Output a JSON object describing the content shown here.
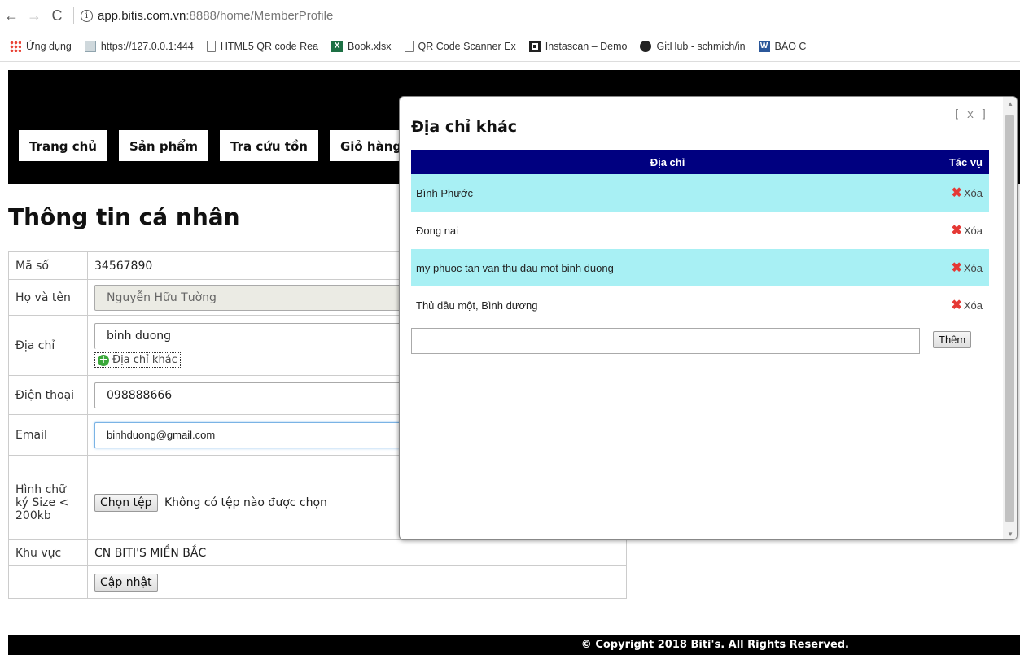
{
  "browser": {
    "url_host": "app.bitis.com.vn",
    "url_path": ":8888/home/MemberProfile",
    "bookmarks": [
      "Ứng dụng",
      "https://127.0.0.1:444",
      "HTML5 QR code Rea",
      "Book.xlsx",
      "QR Code Scanner Ex",
      "Instascan – Demo",
      "GitHub - schmich/in",
      "BÁO C"
    ]
  },
  "header": {
    "menu": [
      "Trang chủ",
      "Sản phẩm",
      "Tra cứu tồn",
      "Giỏ hàng"
    ]
  },
  "profile": {
    "title": "Thông tin cá nhân",
    "labels": {
      "ma_so": "Mã số",
      "ho_ten": "Họ và tên",
      "dia_chi": "Địa chỉ",
      "dien_thoai": "Điện thoại",
      "email": "Email",
      "hinh_chu_ky": "Hình chữ ký Size < 200kb",
      "khu_vuc": "Khu vực"
    },
    "values": {
      "ma_so": "34567890",
      "ho_ten": "Nguyễn Hữu Tường",
      "dia_chi": "binh duong",
      "dien_thoai": "098888666",
      "email": "binhduong@gmail.com",
      "file_status": "Không có tệp nào được chọn",
      "khu_vuc": "CN BITI'S MIỀN BẮC"
    },
    "other_address_link": "Địa chỉ khác",
    "choose_file_button": "Chọn tệp",
    "update_button": "Cập nhật"
  },
  "modal": {
    "title": "Địa chỉ khác",
    "close": "[ x ]",
    "col_address": "Địa chỉ",
    "col_action": "Tác vụ",
    "rows": [
      {
        "address": "Bình Phước",
        "action": "Xóa"
      },
      {
        "address": "Đong nai",
        "action": "Xóa"
      },
      {
        "address": "my phuoc tan van thu dau mot binh duong",
        "action": "Xóa"
      },
      {
        "address": "Thủ dầu một, Bình dương",
        "action": "Xóa"
      }
    ],
    "add_button": "Thêm"
  },
  "footer": {
    "copyright": "© Copyright 2018 Biti's. All Rights Reserved."
  }
}
